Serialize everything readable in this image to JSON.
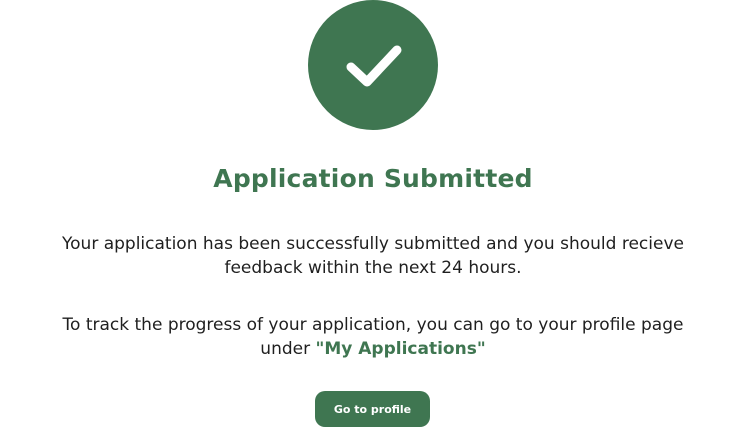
{
  "icon": {
    "name": "check-icon",
    "color": "#3f7651"
  },
  "title": "Application Submitted",
  "message_1": {
    "line_1": "Your application has been successfully submitted and you should recieve",
    "line_2": "feedback within the next 24 hours."
  },
  "message_2": {
    "line_1": "To track the progress of your application, you can go to your profile page",
    "line_2_prefix": "under ",
    "line_2_link": "\"My Applications\""
  },
  "button": {
    "label": "Go to profile"
  },
  "colors": {
    "accent": "#3f7651",
    "text": "#1f1f1f",
    "background": "#ffffff"
  }
}
